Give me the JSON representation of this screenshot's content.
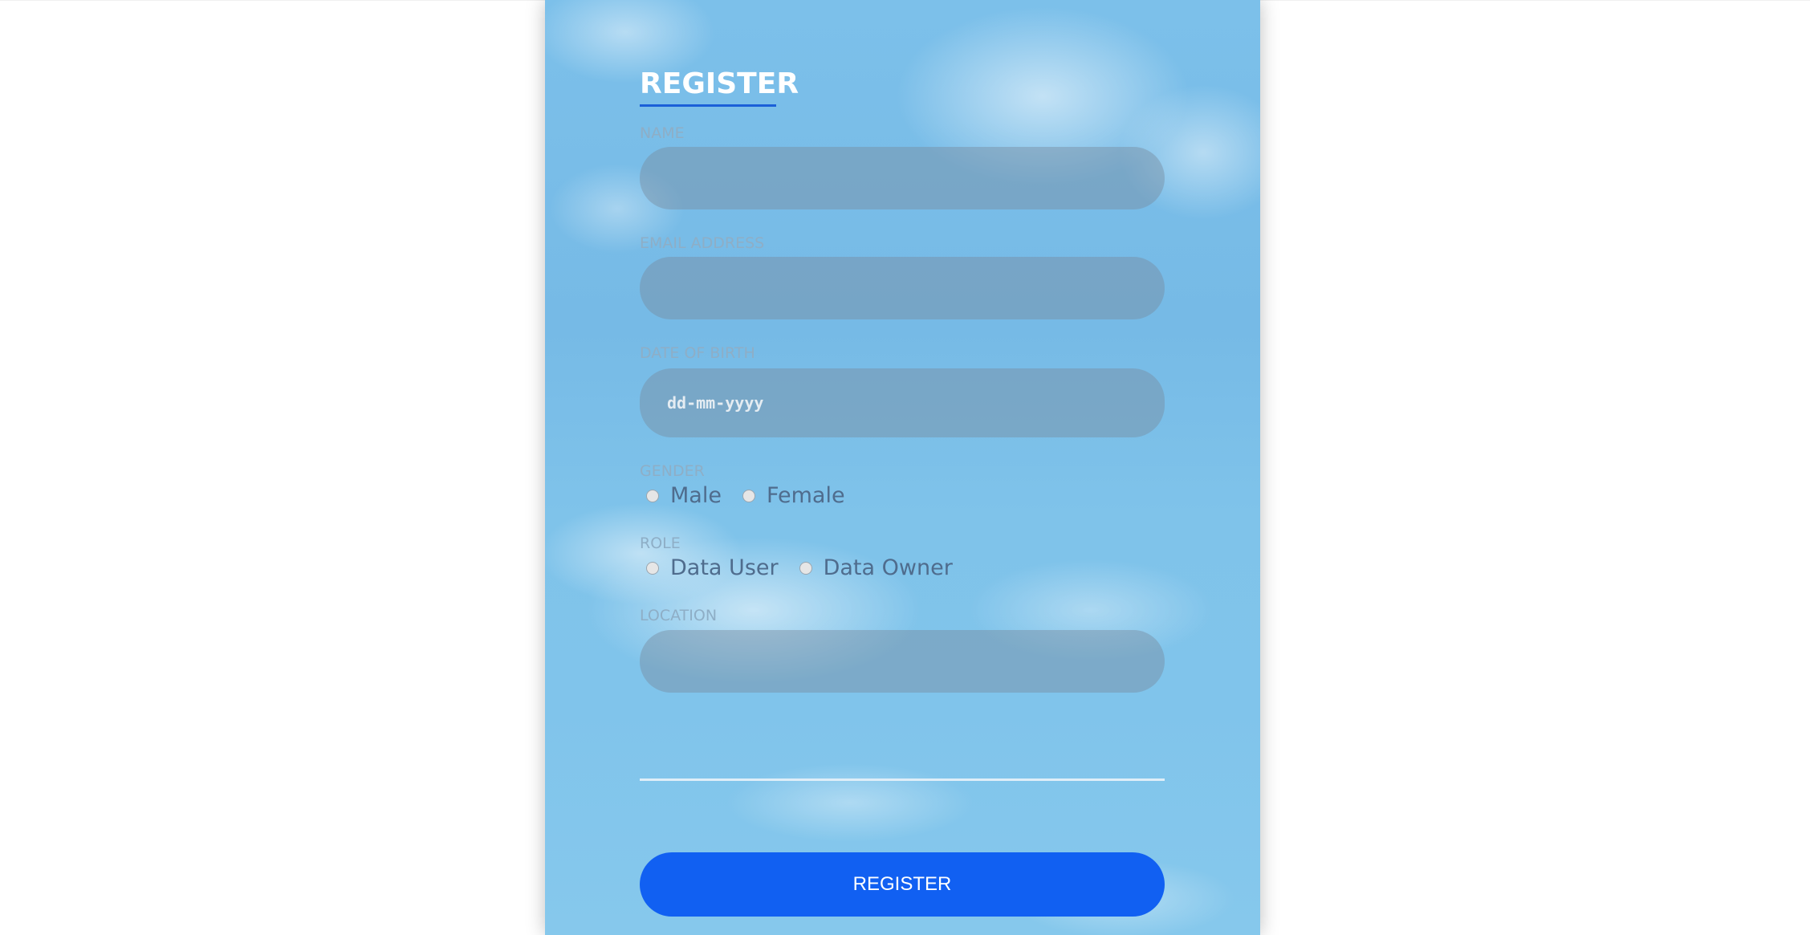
{
  "form": {
    "title": "REGISTER",
    "name_label": "NAME",
    "name_value": "",
    "email_label": "EMAIL ADDRESS",
    "email_value": "",
    "dob_label": "DATE OF BIRTH",
    "dob_placeholder": "dd-mm-yyyy",
    "gender_label": "GENDER",
    "gender_options": [
      "Male",
      "Female"
    ],
    "role_label": "ROLE",
    "role_options": [
      "Data User",
      "Data Owner"
    ],
    "location_label": "LOCATION",
    "location_value": "",
    "submit_label": "REGISTER"
  },
  "colors": {
    "accent": "#1160f2",
    "page_background": "#ffffff",
    "card_sky": "#7cc0ea",
    "field_fill": "#8ea8ba",
    "label_text": "#8eaec6",
    "option_text": "#4f6c8d"
  }
}
